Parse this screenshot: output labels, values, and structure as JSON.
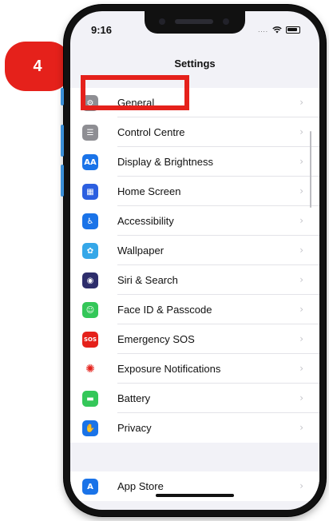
{
  "badge": {
    "number": "4"
  },
  "status_bar": {
    "time": "9:16",
    "signal": "...."
  },
  "nav": {
    "title": "Settings"
  },
  "settings_group_1": [
    {
      "label": "General",
      "icon": "gear-icon",
      "color": "#8e8e93",
      "glyph": "⚙"
    },
    {
      "label": "Control Centre",
      "icon": "switches-icon",
      "color": "#8e8e93",
      "glyph": "☰"
    },
    {
      "label": "Display & Brightness",
      "icon": "text-size-icon",
      "color": "#1a73e8",
      "glyph": "AA"
    },
    {
      "label": "Home Screen",
      "icon": "home-grid-icon",
      "color": "#2c5fe0",
      "glyph": "▦"
    },
    {
      "label": "Accessibility",
      "icon": "accessibility-icon",
      "color": "#1a73e8",
      "glyph": "♿"
    },
    {
      "label": "Wallpaper",
      "icon": "flower-icon",
      "color": "#35a7e8",
      "glyph": "✿"
    },
    {
      "label": "Siri & Search",
      "icon": "siri-icon",
      "color": "#2d2d6b",
      "glyph": "◉"
    },
    {
      "label": "Face ID & Passcode",
      "icon": "face-id-icon",
      "color": "#34c759",
      "glyph": "☺"
    },
    {
      "label": "Emergency SOS",
      "icon": "sos-icon",
      "color": "#e5211b",
      "glyph": "SOS"
    },
    {
      "label": "Exposure Notifications",
      "icon": "exposure-icon",
      "color": "#ffffff",
      "glyph": "✺"
    },
    {
      "label": "Battery",
      "icon": "battery-icon",
      "color": "#34c759",
      "glyph": "▬"
    },
    {
      "label": "Privacy",
      "icon": "hand-icon",
      "color": "#1a73e8",
      "glyph": "✋"
    }
  ],
  "settings_group_2": [
    {
      "label": "App Store",
      "icon": "app-store-icon",
      "color": "#1a73e8",
      "glyph": "A"
    }
  ],
  "chevron": "›",
  "colors": {
    "highlight": "#e5211b",
    "background": "#f2f2f7"
  }
}
